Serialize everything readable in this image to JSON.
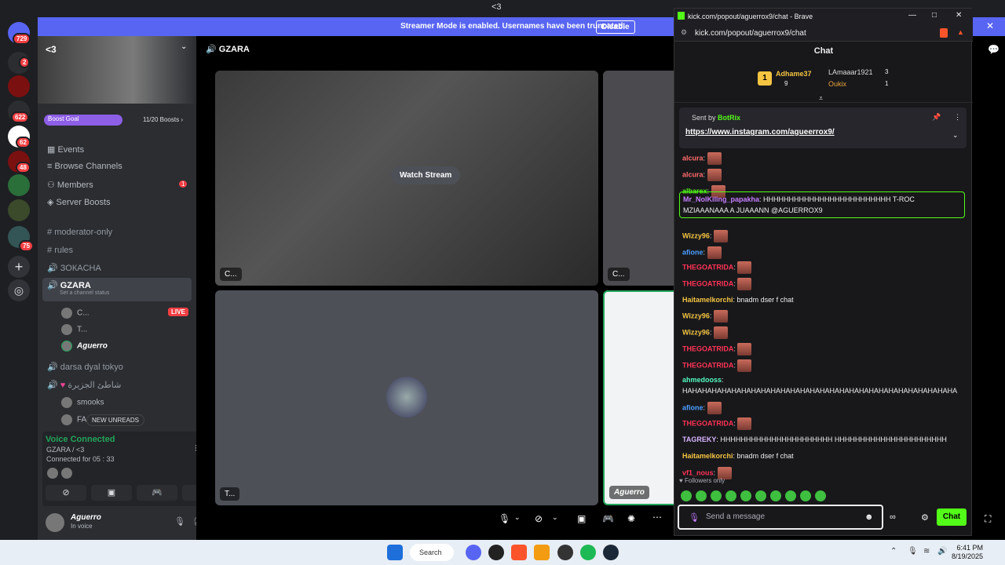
{
  "window_title": "<3",
  "banner": {
    "text": "Streamer Mode is enabled. Usernames have been truncated.",
    "button": "Disable"
  },
  "rail_badges": [
    "729",
    "2",
    "622",
    "62",
    "48",
    "75"
  ],
  "server": {
    "name": "<3",
    "boost_label": "Boost Goal",
    "boost_count": "11/20 Boosts ›"
  },
  "nav": [
    "Events",
    "Browse Channels",
    "Members",
    "Server Boosts"
  ],
  "members_badge": "1",
  "channels": {
    "moderator": "moderator-only",
    "rules": "rules",
    "zokacha": "ЗОКАCHA",
    "gzara": "GZARA",
    "gzara_status": "Set a channel status",
    "sub1": "C...",
    "sub2": "T...",
    "sub3": "Aguerro",
    "live": "LIVE",
    "darsa": "darsa dyal tokyo",
    "arabic": "شاطئ الجزيرة",
    "smooks": "smooks",
    "fa": "FA...",
    "new_unreads": "NEW UNREADS"
  },
  "voice": {
    "connected": "Voice Connected",
    "channel": "GZARA / <3",
    "duration": "Connected for 05 : 33"
  },
  "user": {
    "name": "Aguerro",
    "status": "In voice"
  },
  "stage": {
    "header": "GZARA",
    "watch_stream": "Watch Stream",
    "tile1_label": "C...",
    "tile2_label": "C...",
    "tile3_label": "T...",
    "tile4_label": "Aguerro"
  },
  "popup": {
    "title": "kick.com/popout/aguerrox9/chat - Brave",
    "url": "kick.com/popout/aguerrox9/chat",
    "chat_header": "Chat",
    "leader1": {
      "rank": "1",
      "name": "Adhame37",
      "count": "9"
    },
    "leader2": {
      "name": "LAmaaar1921",
      "count": "3"
    },
    "leader3": {
      "name": "Oukix",
      "count": "1"
    },
    "pinned_by": "Sent by",
    "pinned_author": "BotRix",
    "pinned_link": "https://www.instagram.com/agueerrox9/",
    "messages": [
      {
        "name": "alcura",
        "text": "",
        "color": "#ff6b6b"
      },
      {
        "name": "alcura",
        "text": "",
        "color": "#ff6b6b"
      },
      {
        "name": "albarex",
        "text": "",
        "color": "#53fc18"
      },
      {
        "name": "Mr_NolKiling_papakha",
        "text": "HHHHHHHHHHHHHHHHHHHHHHHHH T-ROC MZIAAANAAA A JUAAANN @AGUERROX9",
        "color": "#c77dff"
      },
      {
        "name": "Wizzy96",
        "text": "",
        "color": "#f5c542"
      },
      {
        "name": "afione",
        "text": "",
        "color": "#4a9eff"
      },
      {
        "name": "THEGOATRIDA",
        "text": "",
        "color": "#ff3355"
      },
      {
        "name": "THEGOATRIDA",
        "text": "",
        "color": "#ff3355"
      },
      {
        "name": "Haitamelkorchi",
        "text": "bnadm dser f chat",
        "color": "#f5c542"
      },
      {
        "name": "Wizzy96",
        "text": "",
        "color": "#f5c542"
      },
      {
        "name": "Wizzy96",
        "text": "",
        "color": "#f5c542"
      },
      {
        "name": "THEGOATRIDA",
        "text": "",
        "color": "#ff3355"
      },
      {
        "name": "THEGOATRIDA",
        "text": "",
        "color": "#ff3355"
      },
      {
        "name": "ahmedooss",
        "text": "HAHAHAHAHAHAHAHAHAHAHAHAHAHAHAHAHAHAHAHAHAHAHAHAHAHAHAHA",
        "color": "#53fcc1"
      },
      {
        "name": "afione",
        "text": "",
        "color": "#4a9eff"
      },
      {
        "name": "THEGOATRIDA",
        "text": "",
        "color": "#ff3355"
      },
      {
        "name": "TAGREKY",
        "text": "HHHHHHHHHHHHHHHHHHHHHH HHHHHHHHHHHHHHHHHHHHHH",
        "color": "#d8b4fe"
      },
      {
        "name": "Haitamelkorchi",
        "text": "bnadm dser f chat",
        "color": "#f5c542"
      },
      {
        "name": "vf1_nous",
        "text": "",
        "color": "#ff3355"
      }
    ],
    "followers_only": "Followers only",
    "input_placeholder": "Send a message",
    "chat_button": "Chat"
  },
  "taskbar": {
    "search": "Search",
    "time": "6:41 PM",
    "date": "8/19/2025"
  }
}
